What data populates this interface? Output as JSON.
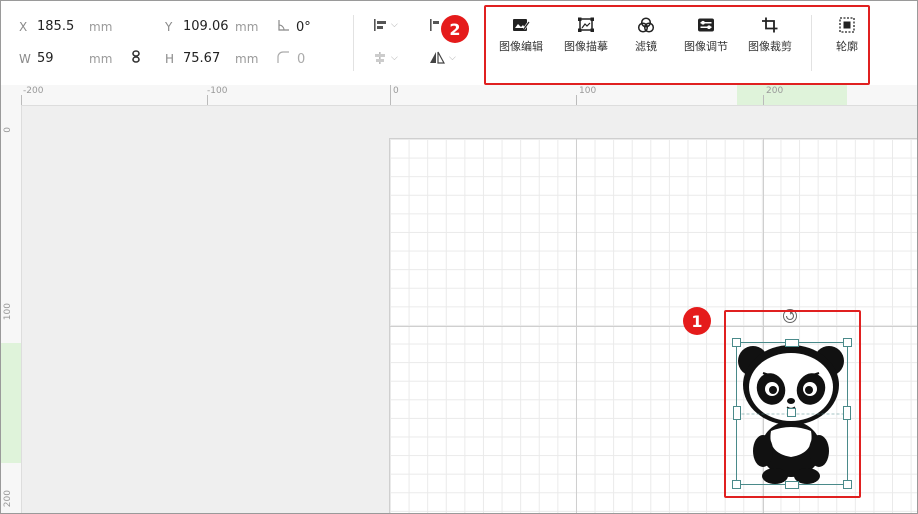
{
  "properties": {
    "x": {
      "label": "X",
      "value": "185.5",
      "unit": "mm"
    },
    "y": {
      "label": "Y",
      "value": "109.06",
      "unit": "mm"
    },
    "w": {
      "label": "W",
      "value": "59",
      "unit": "mm"
    },
    "h": {
      "label": "H",
      "value": "75.67",
      "unit": "mm"
    },
    "rotation": "0°",
    "corner_radius": "0"
  },
  "toolbar": {
    "tools": [
      {
        "label": "图像编辑",
        "icon": "image-edit-icon"
      },
      {
        "label": "图像描摹",
        "icon": "image-trace-icon"
      },
      {
        "label": "滤镜",
        "icon": "filter-icon"
      },
      {
        "label": "图像调节",
        "icon": "image-adjust-icon"
      },
      {
        "label": "图像裁剪",
        "icon": "crop-icon"
      },
      {
        "label": "轮廓",
        "icon": "outline-icon"
      }
    ]
  },
  "rulers": {
    "top": [
      "-200",
      "-100",
      "0",
      "100",
      "200"
    ],
    "left": [
      "0",
      "100",
      "200"
    ]
  },
  "badges": {
    "one": "1",
    "two": "2"
  },
  "colors": {
    "highlight": "#e02020",
    "badge": "#e51b1b",
    "selection": "#4a8a8a"
  }
}
